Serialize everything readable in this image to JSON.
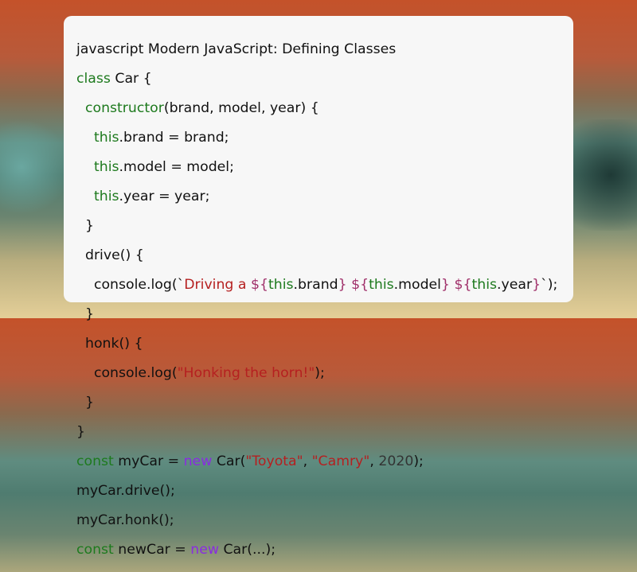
{
  "title": "javascript Modern JavaScript: Defining Classes",
  "code": {
    "l2_kw": "class",
    "l2_rest": " Car {",
    "l3_indent": "  ",
    "l3_kw": "constructor",
    "l3_rest": "(brand, model, year) {",
    "l4_indent": "    ",
    "l4_kw": "this",
    "l4_rest": ".brand = brand;",
    "l5_indent": "    ",
    "l5_kw": "this",
    "l5_rest": ".model = model;",
    "l6_indent": "    ",
    "l6_kw": "this",
    "l6_rest": ".year = year;",
    "l7": "  }",
    "l8": "  drive() {",
    "l9_pre": "    console.log(",
    "l9_tick": "`",
    "l9_str1": "Driving a ",
    "l9_i1a": "${",
    "l9_i1kw": "this",
    "l9_i1b": ".brand",
    "l9_i1c": "}",
    "l9_sp1": " ",
    "l9_i2a": "${",
    "l9_i2kw": "this",
    "l9_i2b": ".model",
    "l9_i2c": "}",
    "l9_sp2": " ",
    "l9_i3a": "${",
    "l9_i3kw": "this",
    "l9_i3b": ".year",
    "l9_i3c": "}",
    "l9_tick2": "`",
    "l9_end": ");",
    "l10": "  }",
    "l11": "  honk() {",
    "l12_pre": "    console.log(",
    "l12_str": "\"Honking the horn!\"",
    "l12_end": ");",
    "l13": "  }",
    "l14": "}",
    "l15_kw": "const",
    "l15_a": " myCar = ",
    "l15_new": "new",
    "l15_b": " Car(",
    "l15_s1": "\"Toyota\"",
    "l15_c": ", ",
    "l15_s2": "\"Camry\"",
    "l15_d": ", ",
    "l15_num": "2020",
    "l15_e": ");",
    "l16": "myCar.drive();",
    "l17": "myCar.honk();",
    "l18_kw": "const",
    "l18_a": " newCar = ",
    "l18_new": "new",
    "l18_b": " Car(...);"
  }
}
